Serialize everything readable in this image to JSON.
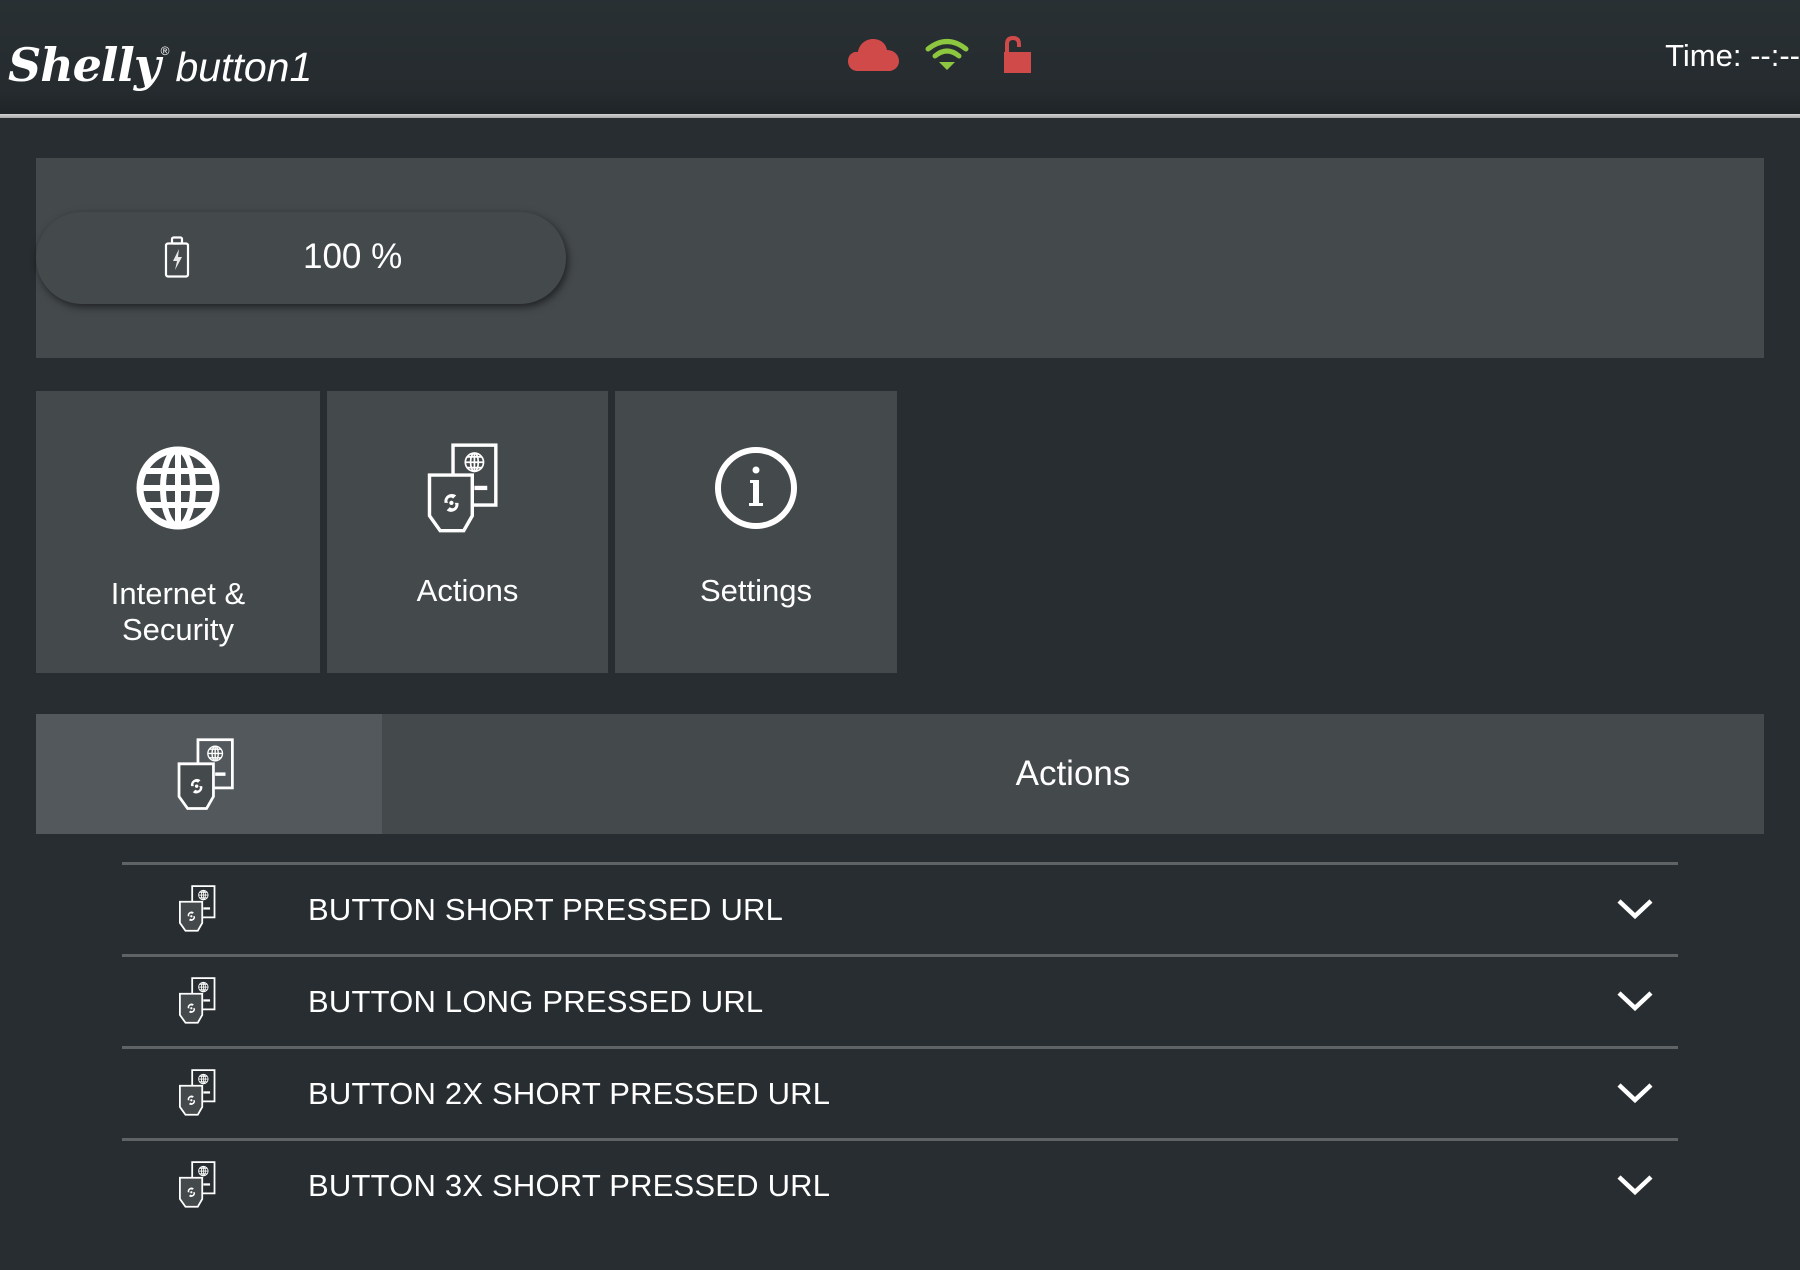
{
  "header": {
    "brand": "Shelly",
    "registered_mark": "®",
    "model": "button1",
    "time_label": "Time: --:--",
    "status_icons": [
      {
        "name": "cloud-icon",
        "state": "disconnected",
        "color": "#d04a4a"
      },
      {
        "name": "wifi-icon",
        "state": "connected",
        "color": "#8dc63f"
      },
      {
        "name": "lock-icon",
        "state": "unlocked",
        "color": "#d04a4a"
      }
    ]
  },
  "battery": {
    "icon": "battery-charging-icon",
    "value": "100 %",
    "percent": 100
  },
  "tiles": [
    {
      "icon": "globe-icon",
      "label": "Internet &\nSecurity",
      "label_line1": "Internet &",
      "label_line2": "Security"
    },
    {
      "icon": "actions-icon",
      "label": "Actions"
    },
    {
      "icon": "info-icon",
      "label": "Settings"
    }
  ],
  "section": {
    "icon": "actions-icon",
    "title": "Actions"
  },
  "actions": [
    {
      "label": "BUTTON SHORT PRESSED URL",
      "icon": "actions-icon",
      "expand_icon": "chevron-down-icon"
    },
    {
      "label": "BUTTON LONG PRESSED URL",
      "icon": "actions-icon",
      "expand_icon": "chevron-down-icon"
    },
    {
      "label": "BUTTON 2X SHORT PRESSED URL",
      "icon": "actions-icon",
      "expand_icon": "chevron-down-icon"
    },
    {
      "label": "BUTTON 3X SHORT PRESSED URL",
      "icon": "actions-icon",
      "expand_icon": "chevron-down-icon"
    }
  ],
  "colors": {
    "background": "#272d30",
    "panel": "#44494c",
    "panel_highlight": "#52585b",
    "separator": "#5f6366",
    "alert_red": "#d04a4a",
    "ok_green": "#8dc63f"
  }
}
